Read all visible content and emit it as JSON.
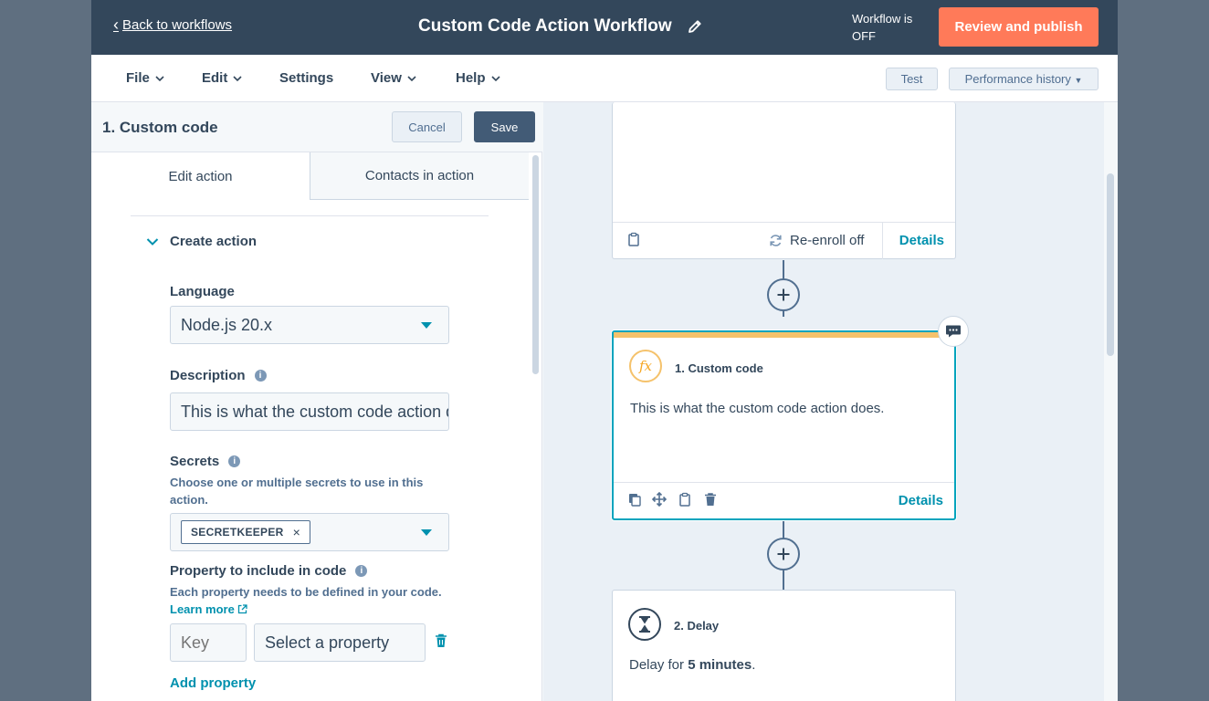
{
  "header": {
    "back_label": "Back to workflows",
    "title": "Custom Code Action Workflow",
    "status_line1": "Workflow is",
    "status_line2": "OFF",
    "publish_label": "Review and publish"
  },
  "menubar": {
    "items": [
      {
        "label": "File"
      },
      {
        "label": "Edit"
      },
      {
        "label": "Settings"
      },
      {
        "label": "View"
      },
      {
        "label": "Help"
      }
    ],
    "test_label": "Test",
    "history_label": "Performance history"
  },
  "panel": {
    "title": "1. Custom code",
    "cancel_label": "Cancel",
    "save_label": "Save",
    "tabs": [
      {
        "label": "Edit action",
        "active": true
      },
      {
        "label": "Contacts in action",
        "active": false
      }
    ],
    "section_label": "Create action",
    "language": {
      "label": "Language",
      "value": "Node.js 20.x"
    },
    "description": {
      "label": "Description",
      "value": "This is what the custom code action does."
    },
    "secrets": {
      "label": "Secrets",
      "help": "Choose one or multiple secrets to use in this action.",
      "selected": [
        "SECRETKEEPER"
      ]
    },
    "property": {
      "label": "Property to include in code",
      "help": "Each property needs to be defined in your code.",
      "learn_more": "Learn more",
      "key_placeholder": "Key",
      "property_placeholder": "Select a property"
    },
    "add_property_label": "Add property"
  },
  "canvas": {
    "trigger_card": {
      "reenroll_label": "Re-enroll off",
      "details_label": "Details"
    },
    "custom_code_card": {
      "title": "1. Custom code",
      "icon_text": "fx",
      "description": "This is what the custom code action does.",
      "details_label": "Details",
      "accent_color": "#f5c26b"
    },
    "delay_card": {
      "title": "2. Delay",
      "desc_prefix": "Delay for ",
      "desc_value": "5 minutes",
      "desc_suffix": "."
    }
  },
  "colors": {
    "header_bg": "#33475b",
    "publish_bg": "#ff7a59",
    "link": "#0091ae",
    "selected_border": "#00a4bd"
  }
}
